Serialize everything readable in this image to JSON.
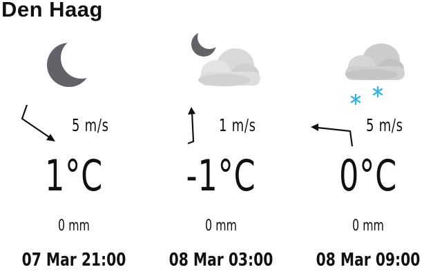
{
  "location": {
    "name": "Den Haag"
  },
  "colors": {
    "moon": "#616368",
    "cloud_light": "#e6e6e6",
    "cloud_mid": "#cfcfcf",
    "cloud_dark": "#bdbdbd",
    "snow": "#3ab3e0",
    "text": "#111111"
  },
  "forecast": [
    {
      "time": "07 Mar 21:00",
      "icon": "moon-icon",
      "wind_speed": "5 m/s",
      "temperature": "1°C",
      "precipitation": "0 mm"
    },
    {
      "time": "08 Mar 03:00",
      "icon": "partly-cloudy-night-icon",
      "wind_speed": "1 m/s",
      "temperature": "-1°C",
      "precipitation": "0 mm"
    },
    {
      "time": "08 Mar 09:00",
      "icon": "snow-cloud-icon",
      "wind_speed": "5 m/s",
      "temperature": "0°C",
      "precipitation": "0 mm"
    }
  ]
}
